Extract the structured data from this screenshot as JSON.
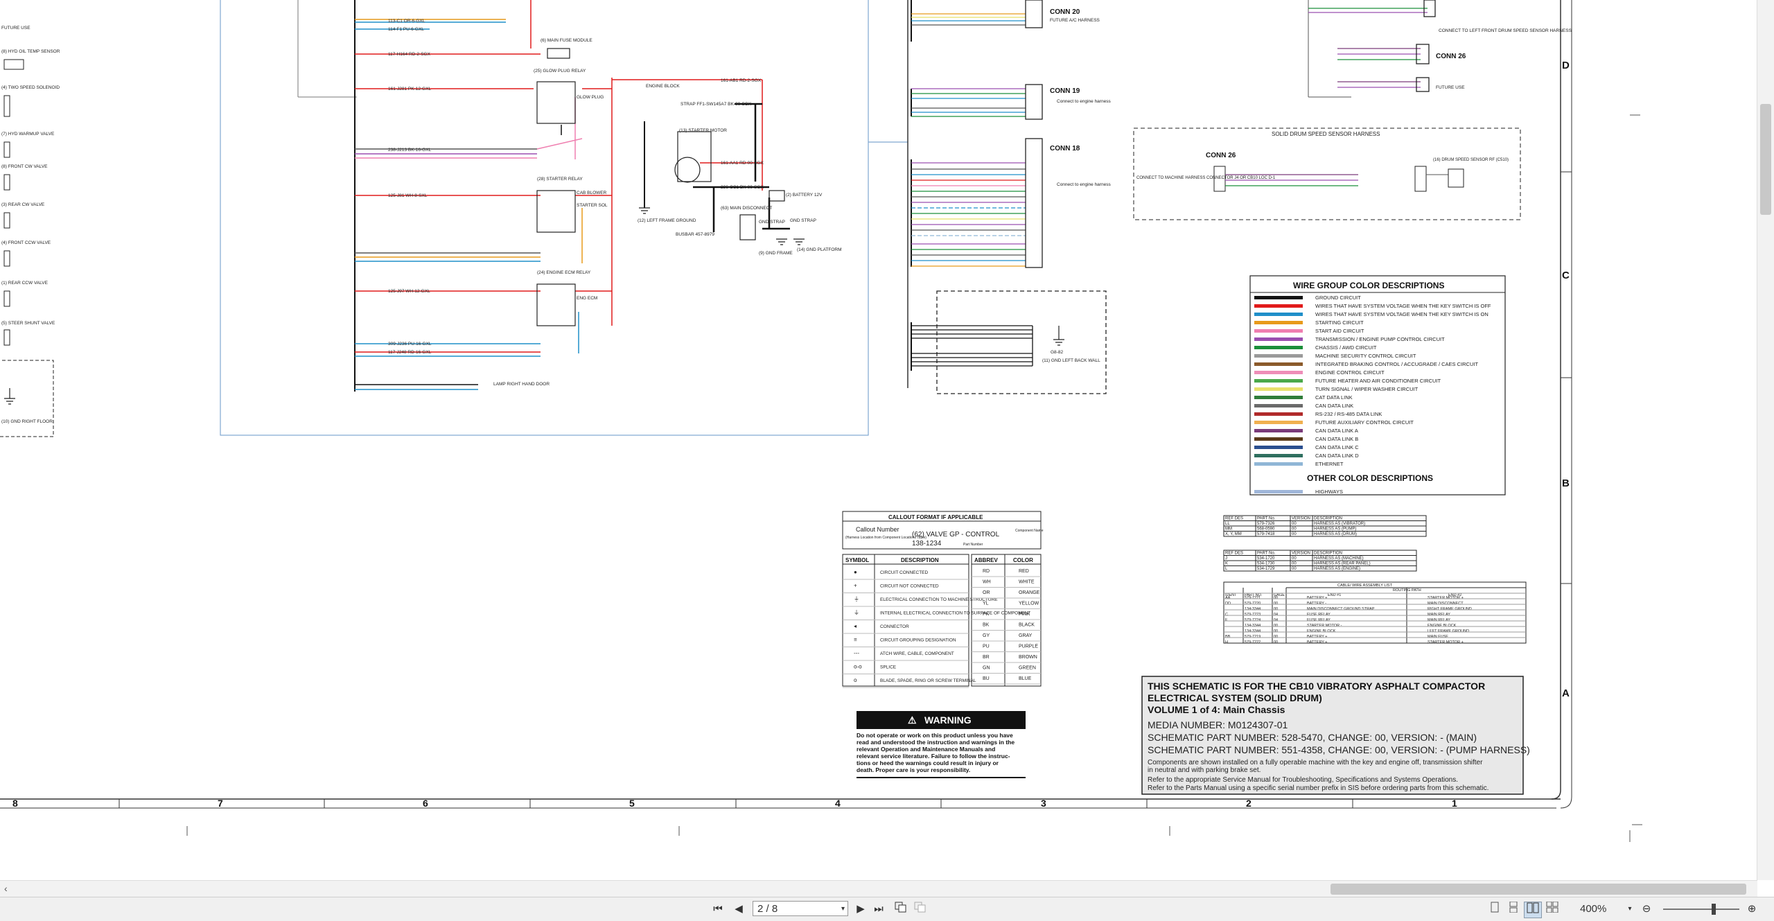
{
  "viewer": {
    "page_current": "2 / 8",
    "zoom_level": "400%",
    "buttons": {
      "first": "⏮",
      "prev": "◀",
      "next": "▶",
      "last": "⏭",
      "zoom_out": "⊖",
      "zoom_in": "⊕",
      "caret": "▾",
      "scroll_left": "‹"
    }
  },
  "schematic": {
    "grid_numbers": [
      "8",
      "7",
      "6",
      "5",
      "4",
      "3",
      "2",
      "1"
    ],
    "grid_letters": [
      "D",
      "C",
      "B",
      "A"
    ],
    "left_labels": [
      "FUTURE USE",
      "(8) HYD OIL TEMP SENSOR",
      "(4) TWO SPEED SOLENOID",
      "(7) HYD WARMUP VALVE",
      "(8) FRONT CW VALVE",
      "(3) REAR CW VALVE",
      "(4) FRONT CCW VALVE",
      "(1) REAR CCW VALVE",
      "(5) STEER SHUNT VALVE",
      "(10) GND RIGHT FLOOR"
    ],
    "wire_labels": [
      "113-C1 OR-6-GXL",
      "114-F1 PU-6-GXL",
      "117-H164 RD-2-SGX",
      "161-J281 PK-12-GXL",
      "238-J213 BK-16-GXL",
      "125-J81 WH-8-SXL",
      "125-J97 WH-12-GXL",
      "309-J236 PU-16-GXL",
      "117-J248 RD-16-GXL",
      "161-AB1 RD-2-SGX",
      "161-AA1 RD-00-SGX",
      "236-CC1 BK-00-SGX"
    ],
    "component_labels": [
      "(6) MAIN FUSE MODULE",
      "(25) GLOW PLUG RELAY",
      "GLOW PLUG",
      "(28) STARTER RELAY",
      "CAB BLOWER",
      "STARTER SOL",
      "(24) ENGINE ECM RELAY",
      "ENG ECM",
      "ENGINE BLOCK",
      "STRAP FF1-SW145A7 BK-00-SGX",
      "(13) STARTER MOTOR",
      "(2) BATTERY 12V",
      "(63) MAIN DISCONNECT",
      "(12) LEFT FRAME GROUND",
      "BUSBAR 457-8979",
      "GND STRAP",
      "GND STRAP",
      "(9) GND FRAME",
      "(14) GND PLATFORM",
      "LAMP RIGHT HAND DOOR"
    ],
    "connectors": {
      "conn20": "CONN 20",
      "conn20_sub": "FUTURE A/C HARNESS",
      "conn19": "CONN 19",
      "conn19_note": "Connect to engine harness",
      "conn18": "CONN 18",
      "conn18_note": "Connect to engine harness",
      "conn26_top": "CONN 26",
      "conn26_note": "CONNECT TO LEFT FRONT DRUM SPEED SENSOR HARNESS",
      "future_use": "FUTURE USE",
      "gnd_left_back": "(11) GND LEFT BACK WALL",
      "g": "G8-82"
    },
    "solid_drum": {
      "title": "SOLID DRUM SPEED SENSOR HARNESS",
      "conn": "CONN 26",
      "connect_note": "CONNECT TO MACHINE HARNESS CONNECTOR J4 OR CB10 LOC D-1",
      "sensor": "(16) DRUM SPEED SENSOR RF (C510)"
    },
    "wire_group": {
      "title": "WIRE GROUP COLOR DESCRIPTIONS",
      "rows": [
        {
          "label": "GROUND CIRCUIT",
          "color": "#111111"
        },
        {
          "label": "WIRES THAT HAVE SYSTEM VOLTAGE WHEN THE KEY SWITCH IS OFF",
          "color": "#e11b1b"
        },
        {
          "label": "WIRES THAT HAVE SYSTEM VOLTAGE WHEN THE KEY SWITCH IS ON",
          "color": "#1f8fc9"
        },
        {
          "label": "STARTING CIRCUIT",
          "color": "#e89a1b"
        },
        {
          "label": "START AID CIRCUIT",
          "color": "#ef7fb0"
        },
        {
          "label": "TRANSMISSION / ENGINE PUMP CONTROL CIRCUIT",
          "color": "#9b4fb0"
        },
        {
          "label": "CHASSIS / AWD CIRCUIT",
          "color": "#1b8f3a"
        },
        {
          "label": "MACHINE SECURITY CONTROL CIRCUIT",
          "color": "#9a9a9a"
        },
        {
          "label": "INTEGRATED BRAKING CONTROL / ACCUGRADE / CAES CIRCUIT",
          "color": "#8b5a2b"
        },
        {
          "label": "ENGINE CONTROL CIRCUIT",
          "color": "#ee8eb8"
        },
        {
          "label": "FUTURE HEATER AND AIR CONDITIONER CIRCUIT",
          "color": "#4aa84a"
        },
        {
          "label": "TURN SIGNAL / WIPER WASHER CIRCUIT",
          "color": "#e8e06b"
        },
        {
          "label": "CAT DATA LINK",
          "color": "#2f7d3a"
        },
        {
          "label": "CAN DATA LINK",
          "color": "#6a6a6a"
        },
        {
          "label": "RS-232 / RS-485 DATA LINK",
          "color": "#b02a2a"
        },
        {
          "label": "FUTURE AUXILIARY CONTROL CIRCUIT",
          "color": "#f0b050"
        },
        {
          "label": "CAN DATA LINK A",
          "color": "#7a3b7a"
        },
        {
          "label": "CAN DATA LINK B",
          "color": "#5a3b1a"
        },
        {
          "label": "CAN DATA LINK C",
          "color": "#2a4f8f"
        },
        {
          "label": "CAN DATA LINK D",
          "color": "#2f6f5f"
        },
        {
          "label": "ETHERNET",
          "color": "#8fb6d6"
        }
      ],
      "other_title": "OTHER COLOR DESCRIPTIONS",
      "other_rows": [
        {
          "label": "HIGHWAYS",
          "color": "#9fb6d9"
        }
      ]
    },
    "callout": {
      "title": "CALLOUT FORMAT IF APPLICABLE",
      "callout_number": "Callout Number",
      "callout_number_sub": "(Harness Location from Component Locations Table)",
      "example": "(62) VALVE GP - CONTROL",
      "part": "138-1234",
      "component_name": "Component Name",
      "part_number": "Part Number"
    },
    "symbols": {
      "h_symbol": "SYMBOL",
      "h_desc": "DESCRIPTION",
      "rows": [
        {
          "sym": "●",
          "desc": "CIRCUIT CONNECTED"
        },
        {
          "sym": "+",
          "desc": "CIRCUIT NOT CONNECTED"
        },
        {
          "sym": "⏚",
          "desc": "ELECTRICAL CONNECTION TO MACHINE STRUCTURE"
        },
        {
          "sym": "⏚",
          "desc": "INTERNAL ELECTRICAL CONNECTION TO SURFACE OF COMPONENT"
        },
        {
          "sym": "◂",
          "desc": "CONNECTOR"
        },
        {
          "sym": "≡",
          "desc": "CIRCUIT GROUPING DESIGNATION"
        },
        {
          "sym": "---",
          "desc": "ATCH WIRE, CABLE, COMPONENT"
        },
        {
          "sym": "o-o",
          "desc": "SPLICE"
        },
        {
          "sym": "o",
          "desc": "BLADE, SPADE, RING OR SCREW TERMINAL"
        }
      ]
    },
    "abbrev": {
      "h_abbrev": "ABBREV",
      "h_color": "COLOR",
      "rows": [
        {
          "a": "RD",
          "c": "RED"
        },
        {
          "a": "WH",
          "c": "WHITE"
        },
        {
          "a": "OR",
          "c": "ORANGE"
        },
        {
          "a": "YL",
          "c": "YELLOW"
        },
        {
          "a": "PK",
          "c": "PINK"
        },
        {
          "a": "BK",
          "c": "BLACK"
        },
        {
          "a": "GY",
          "c": "GRAY"
        },
        {
          "a": "PU",
          "c": "PURPLE"
        },
        {
          "a": "BR",
          "c": "BROWN"
        },
        {
          "a": "GN",
          "c": "GREEN"
        },
        {
          "a": "BU",
          "c": "BLUE"
        }
      ]
    },
    "warning": {
      "title": "WARNING",
      "text": [
        "Do not operate or work on this product unless you have",
        "read and understood the instruction and warnings in the",
        "relevant Operation and Maintenance Manuals and",
        "relevant service literature. Failure to follow the instruc-",
        "tions or heed the warnings could result in injury or",
        "death. Proper care is your responsibility."
      ]
    },
    "harness_table": {
      "headers": [
        "REF DES",
        "PART No.",
        "VERSION",
        "DESCRIPTION"
      ],
      "rows": [
        [
          "LL",
          "579-7326",
          "00",
          "HARNESS AS (VIBRATOR)"
        ],
        [
          "MM",
          "568-0590",
          "00",
          "HARNESS AS (PUMP)"
        ],
        [
          "X, Y, MM",
          "579-7418",
          "00",
          "HARNESS AS (DRUM)"
        ]
      ]
    },
    "harness_table2": {
      "headers": [
        "REF DES",
        "PART No.",
        "VERSION",
        "DESCRIPTION"
      ],
      "rows": [
        [
          "J",
          "534-1720",
          "00",
          "HARNESS AS (MACHINE)"
        ],
        [
          "K",
          "534-1730",
          "00",
          "HARNESS AS (REAR PANEL)"
        ],
        [
          "L",
          "534-1729",
          "00",
          "HARNESS AS (ENGINE)"
        ]
      ]
    },
    "cable_table": {
      "title": "CABLE/ WIRE ASSEMBLY LIST",
      "routing": "ROUTING PATH",
      "headers": [
        "IDENT",
        "PART NO.",
        "GAGE",
        "END #1",
        "END #2"
      ],
      "rows": [
        [
          "AA",
          "579-7221",
          "00",
          "BATTERY +",
          "STARTER MOTOR +"
        ],
        [
          "DD",
          "579-7220",
          "00",
          "BATTERY -",
          "MAIN DISCONNECT"
        ],
        [
          "",
          "134-3344",
          "00",
          "MAIN DISCONNECT GROUND STRAP",
          "RIGHT FRAME GROUND"
        ],
        [
          "C",
          "579-7223",
          "04",
          "FUSE RELAY",
          "MAIN RELAY"
        ],
        [
          "F",
          "579-7224",
          "04",
          "FUSE RELAY",
          "MAIN RELAY"
        ],
        [
          "",
          "134-3344",
          "00",
          "STARTER MOTOR -",
          "ENGINE BLOCK"
        ],
        [
          "",
          "134-3344",
          "00",
          "ENGINE BLOCK",
          "LEFT FRAME GROUND"
        ],
        [
          "BB",
          "579-7219",
          "00",
          "BATTERY +",
          "MAIN FUSE"
        ],
        [
          "H",
          "579-7222",
          "00",
          "BATTERY +",
          "STARTER MOTOR +"
        ]
      ]
    },
    "title_block": {
      "line1": "THIS SCHEMATIC IS FOR THE CB10 VIBRATORY ASPHALT COMPACTOR",
      "line2": "ELECTRICAL SYSTEM (SOLID DRUM)",
      "line3": "VOLUME 1 of 4: Main Chassis",
      "media": "MEDIA NUMBER: M0124307-01",
      "part1": "SCHEMATIC PART NUMBER: 528-5470, CHANGE: 00, VERSION: - (MAIN)",
      "part2": "SCHEMATIC PART NUMBER: 551-4358, CHANGE: 00, VERSION: - (PUMP HARNESS)",
      "note1": "Components are shown installed on a fully operable machine with the key and engine off, transmission shifter",
      "note2": "in neutral and with parking brake set.",
      "note3": "Refer to the appropriate Service Manual for Troubleshooting, Specifications and Systems Operations.",
      "note4": "Refer to the Parts Manual using a specific serial number prefix in SIS before ordering parts from this schematic."
    }
  }
}
